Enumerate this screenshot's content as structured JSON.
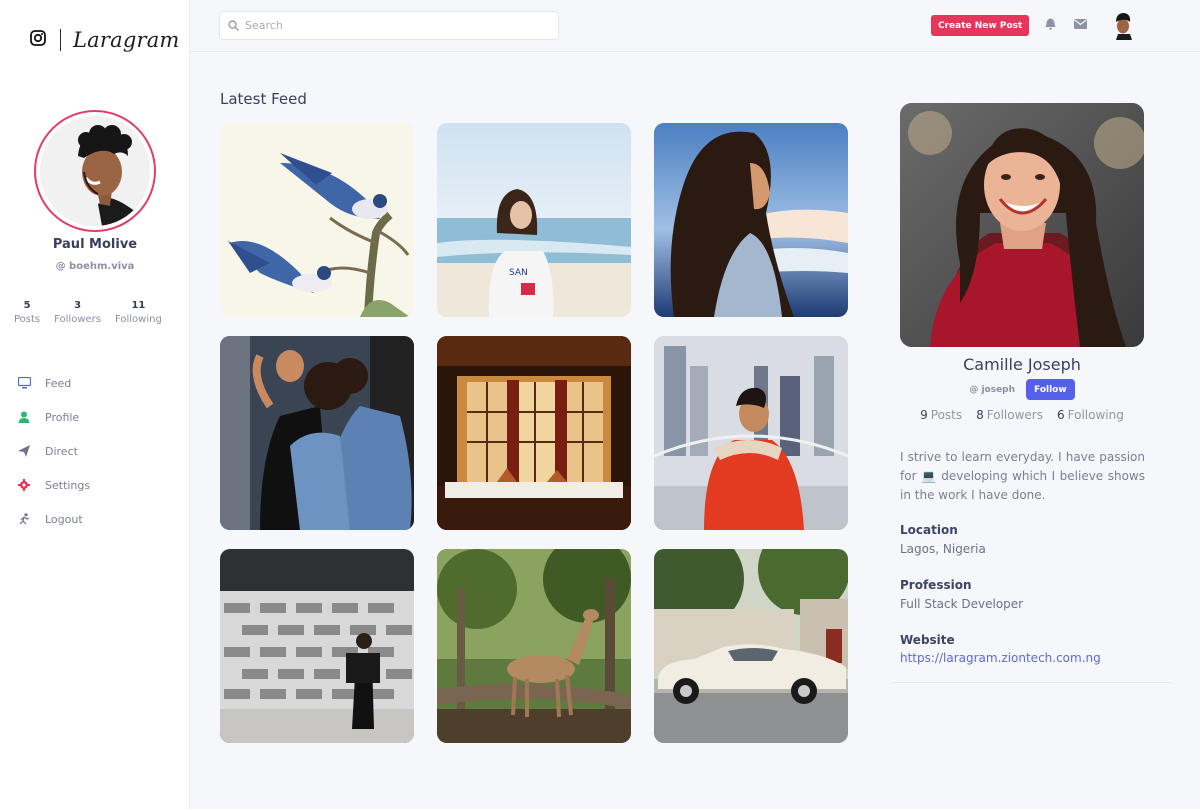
{
  "brand": {
    "name": "Laragram",
    "icon": "instagram-icon"
  },
  "user": {
    "name": "Paul Molive",
    "handle": "@ boehm.viva",
    "stats": [
      {
        "value": "5",
        "label": "Posts"
      },
      {
        "value": "3",
        "label": "Followers"
      },
      {
        "value": "11",
        "label": "Following"
      }
    ]
  },
  "nav": [
    {
      "label": "Feed",
      "icon": "monitor-icon",
      "color": "#5a66e0"
    },
    {
      "label": "Profile",
      "icon": "user-icon",
      "color": "#2bb673"
    },
    {
      "label": "Direct",
      "icon": "send-icon",
      "color": "#6d7486"
    },
    {
      "label": "Settings",
      "icon": "gear-icon",
      "color": "#e6365b"
    },
    {
      "label": "Logout",
      "icon": "run-icon",
      "color": "#6d7486"
    }
  ],
  "topbar": {
    "search_placeholder": "Search",
    "create_label": "Create New Post"
  },
  "feed": {
    "title": "Latest Feed"
  },
  "profile": {
    "name": "Camille Joseph",
    "handle": "@ joseph",
    "follow_label": "Follow",
    "stats": [
      {
        "value": "9",
        "label": "Posts"
      },
      {
        "value": "8",
        "label": "Followers"
      },
      {
        "value": "6",
        "label": "Following"
      }
    ],
    "bio": "I strive to learn everyday. I have passion for 💻 developing which I believe shows in the work I have done.",
    "location_label": "Location",
    "location": "Lagos, Nigeria",
    "profession_label": "Profession",
    "profession": "Full Stack Developer",
    "website_label": "Website",
    "website": "https://laragram.ziontech.com.ng"
  },
  "colors": {
    "accent": "#e6365b",
    "primary": "#5560e9",
    "link": "#5c6ad8"
  }
}
